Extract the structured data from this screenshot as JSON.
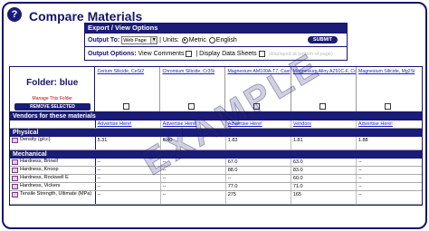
{
  "page": {
    "title": "Compare Materials",
    "help_icon": "?"
  },
  "options": {
    "header": "Export / View Options",
    "output_to_label": "Output To:",
    "output_to_value": "Web Page",
    "units_label": "| Units:",
    "unit_metric": "Metric",
    "unit_english": "English",
    "unit_selected": "Metric",
    "submit_label": "SUBMIT",
    "output_options_label": "Output Options:",
    "view_comments_label": "View Comments",
    "display_datasheets_label": "| Display Data Sheets",
    "datasheets_note": "(displayed at bottom of page)"
  },
  "folder": {
    "name": "Folder: blue",
    "manage_link": "Manage This Folder",
    "remove_button": "REMOVE SELECTED"
  },
  "materials": [
    {
      "name": "Cerium Silicide, CeSi2"
    },
    {
      "name": "Chromium Silicide, Cr3Si"
    },
    {
      "name": "Magnesium AM100A-T7, Cast"
    },
    {
      "name": "Magnesium Alloy AZ91C-F, Cast"
    },
    {
      "name": "Magnesium Silicide, Mg2Si"
    }
  ],
  "vendors": {
    "label": "Vendors for these materials",
    "cells": [
      "Advertise Here!",
      "Advertise Here!",
      "Advertise Here!",
      "Vendors",
      "Advertise Here!"
    ]
  },
  "sections": [
    {
      "title": "Physical",
      "rows": [
        {
          "property": "Density (g/cc)",
          "tall": true,
          "values": [
            "5.31",
            "6.40",
            "1.83",
            "1.81",
            "1.88"
          ]
        }
      ]
    },
    {
      "title": "Mechanical",
      "rows": [
        {
          "property": "Hardness, Brinell",
          "tall": false,
          "values": [
            "--",
            "--",
            "67.0",
            "63.0",
            "--"
          ]
        },
        {
          "property": "Hardness, Knoop",
          "tall": false,
          "values": [
            "--",
            "--",
            "88.0",
            "83.0",
            "--"
          ]
        },
        {
          "property": "Hardness, Rockwell E",
          "tall": false,
          "values": [
            "--",
            "--",
            "--",
            "60.0",
            "--"
          ]
        },
        {
          "property": "Hardness, Vickers",
          "tall": false,
          "values": [
            "--",
            "--",
            "77.0",
            "71.0",
            "--"
          ]
        },
        {
          "property": "Tensile Strength, Ultimate (MPa)",
          "tall": true,
          "values": [
            "--",
            "--",
            "275",
            "165",
            "--"
          ]
        }
      ]
    }
  ],
  "watermark": "EXAMPLE",
  "colors": {
    "navy": "#1b1b78",
    "link": "#1a1acc",
    "warning": "#cc0000"
  }
}
